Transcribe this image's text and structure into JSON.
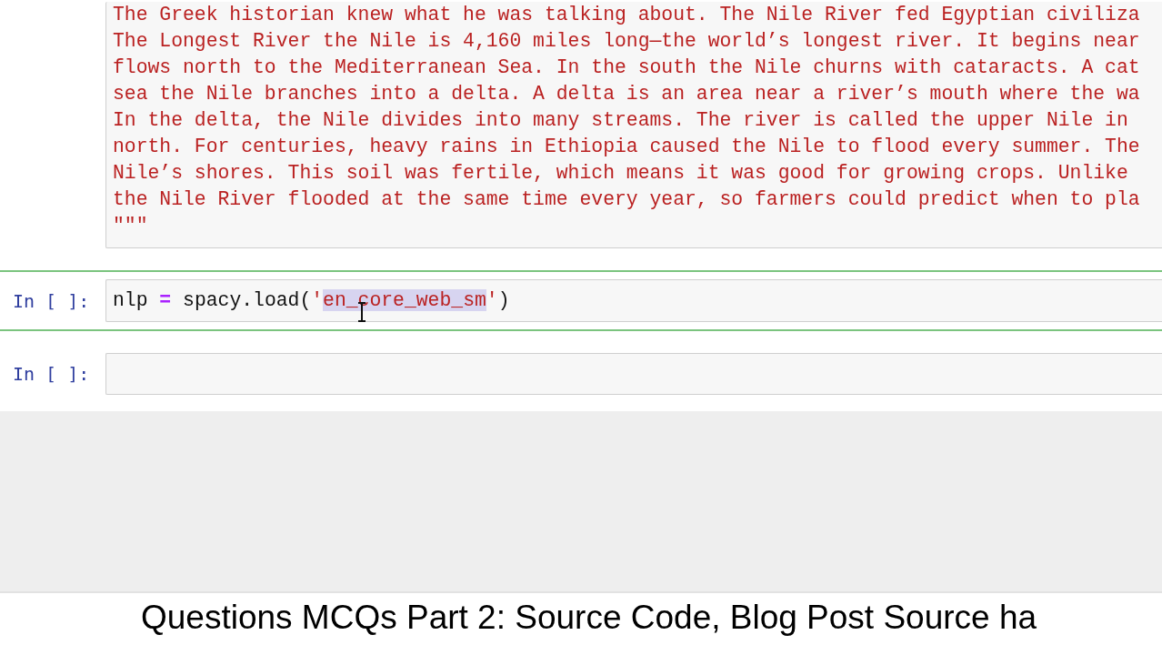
{
  "cells": [
    {
      "kind": "text_block",
      "selected": false,
      "lines": [
        "The Greek historian knew what he was talking about. The Nile River fed Egyptian civiliza",
        "The Longest River the Nile is 4,160 miles long—the world’s longest river. It begins near",
        "flows north to the Mediterranean Sea. In the south the Nile churns with cataracts. A cat",
        "sea the Nile branches into a delta. A delta is an area near a river’s mouth where the wa",
        "In the delta, the Nile divides into many streams. The river is called the upper Nile in",
        "north. For centuries, heavy rains in Ethiopia caused the Nile to flood every summer. The",
        "Nile’s shores. This soil was fertile, which means it was good for growing crops. Unlike",
        "the Nile River flooded at the same time every year, so farmers could predict when to pla",
        "\"\"\""
      ]
    },
    {
      "kind": "code",
      "selected": true,
      "prompt": "In [ ]:",
      "tokens": [
        {
          "text": "nlp ",
          "kind": "plain",
          "selected": false
        },
        {
          "text": "=",
          "kind": "operator",
          "selected": false
        },
        {
          "text": " spacy.load(",
          "kind": "plain",
          "selected": false
        },
        {
          "text": "'",
          "kind": "string",
          "selected": false
        },
        {
          "text": "en_core_web_sm",
          "kind": "string",
          "selected": true
        },
        {
          "text": "'",
          "kind": "string",
          "selected": false
        },
        {
          "text": ")",
          "kind": "plain",
          "selected": false
        }
      ]
    },
    {
      "kind": "code",
      "selected": false,
      "prompt": "In [ ]:"
    }
  ],
  "caption": "Questions MCQs Part 2: Source Code, Blog Post Source ha"
}
